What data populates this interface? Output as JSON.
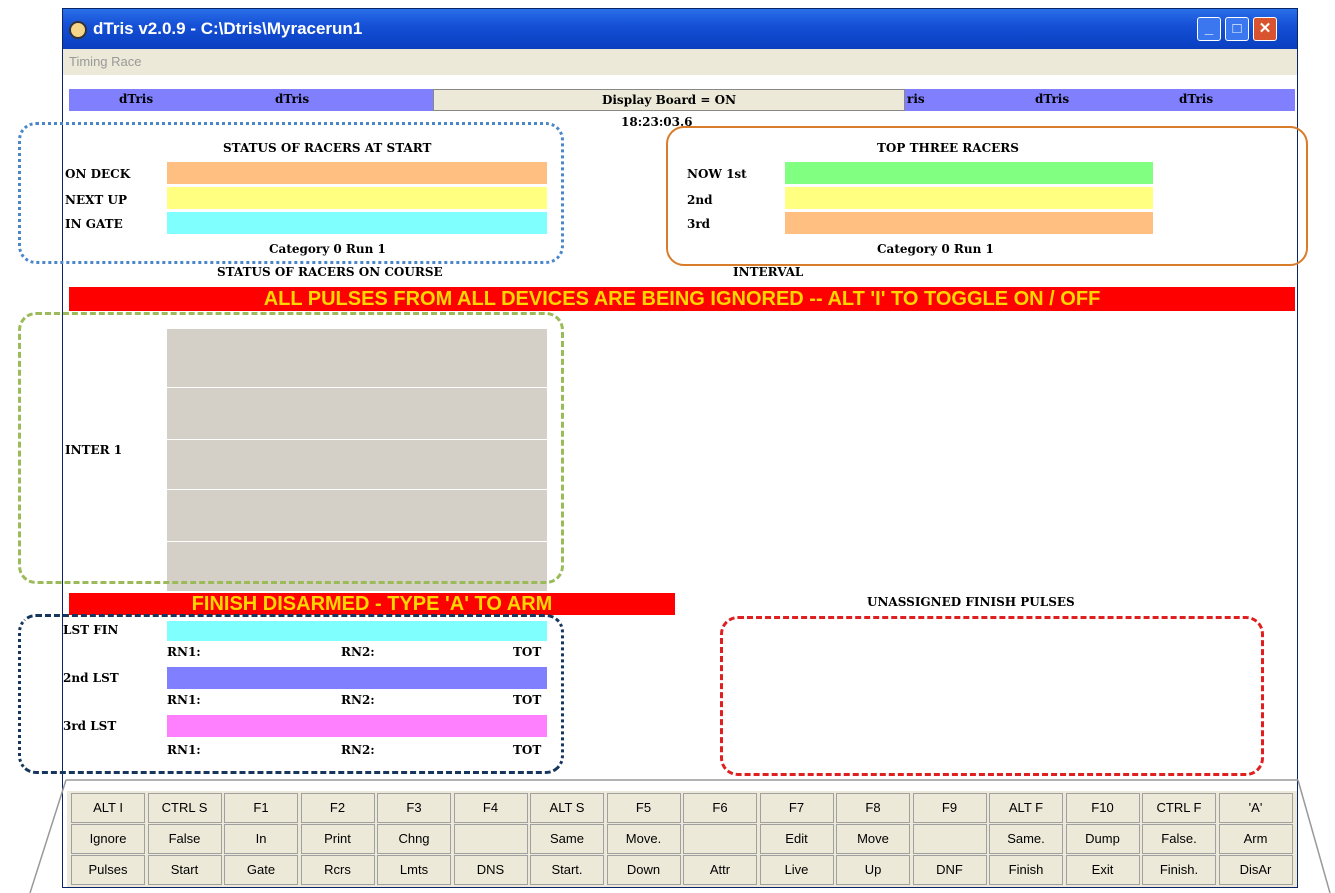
{
  "window": {
    "title": "dTris  v2.0.9 - C:\\Dtris\\Myracerun1",
    "menu": "Timing Race",
    "controls": {
      "minimize": "_",
      "maximize": "□",
      "close": "✕"
    }
  },
  "banner": {
    "labels": [
      "dTris",
      "dTris",
      "ris",
      "dTris",
      "dTris"
    ],
    "display_board": "Display Board = ON"
  },
  "clock": "18:23:03.6",
  "start_status": {
    "title": "STATUS OF RACERS AT START",
    "rows": [
      {
        "label": "ON DECK",
        "color": "#ffbf80"
      },
      {
        "label": "NEXT UP",
        "color": "#ffff80"
      },
      {
        "label": "IN GATE",
        "color": "#80ffff"
      }
    ],
    "footer": "Category 0 Run 1"
  },
  "top_three": {
    "title": "TOP THREE RACERS",
    "rows": [
      {
        "label": "NOW 1st",
        "color": "#80ff80"
      },
      {
        "label": "2nd",
        "color": "#ffff80"
      },
      {
        "label": "3rd",
        "color": "#ffbf80"
      }
    ],
    "footer": "Category 0 Run 1"
  },
  "course": {
    "title": "STATUS OF RACERS ON COURSE",
    "interval": "INTERVAL",
    "inter_label": "INTER 1"
  },
  "alert": "ALL PULSES FROM ALL DEVICES ARE BEING IGNORED -- ALT  'I' TO TOGGLE ON / OFF",
  "finish_alert": "FINISH DISARMED - TYPE  'A' TO ARM",
  "unassigned_title": "UNASSIGNED FINISH PULSES",
  "last_finishers": [
    {
      "label": "LST FIN",
      "color": "#80ffff",
      "rn1": "RN1:",
      "rn2": "RN2:",
      "tot": "TOT"
    },
    {
      "label": "2nd LST",
      "color": "#8080ff",
      "rn1": "RN1:",
      "rn2": "RN2:",
      "tot": "TOT"
    },
    {
      "label": "3rd LST",
      "color": "#ff80ff",
      "rn1": "RN1:",
      "rn2": "RN2:",
      "tot": "TOT"
    }
  ],
  "function_keys": [
    {
      "key": "ALT I",
      "line2": "Ignore",
      "line3": "Pulses"
    },
    {
      "key": "CTRL S",
      "line2": "False",
      "line3": "Start"
    },
    {
      "key": "F1",
      "line2": "In",
      "line3": "Gate"
    },
    {
      "key": "F2",
      "line2": "Print",
      "line3": "Rcrs"
    },
    {
      "key": "F3",
      "line2": "Chng",
      "line3": "Lmts"
    },
    {
      "key": "F4",
      "line2": "",
      "line3": "DNS"
    },
    {
      "key": "ALT S",
      "line2": "Same",
      "line3": "Start."
    },
    {
      "key": "F5",
      "line2": "Move.",
      "line3": "Down"
    },
    {
      "key": "F6",
      "line2": "",
      "line3": "Attr"
    },
    {
      "key": "F7",
      "line2": "Edit",
      "line3": "Live"
    },
    {
      "key": "F8",
      "line2": "Move",
      "line3": "Up"
    },
    {
      "key": "F9",
      "line2": "",
      "line3": "DNF"
    },
    {
      "key": "ALT F",
      "line2": "Same.",
      "line3": "Finish"
    },
    {
      "key": "F10",
      "line2": "Dump",
      "line3": "Exit"
    },
    {
      "key": "CTRL F",
      "line2": "False.",
      "line3": "Finish."
    },
    {
      "key": "'A'",
      "line2": "Arm",
      "line3": "DisAr"
    }
  ]
}
